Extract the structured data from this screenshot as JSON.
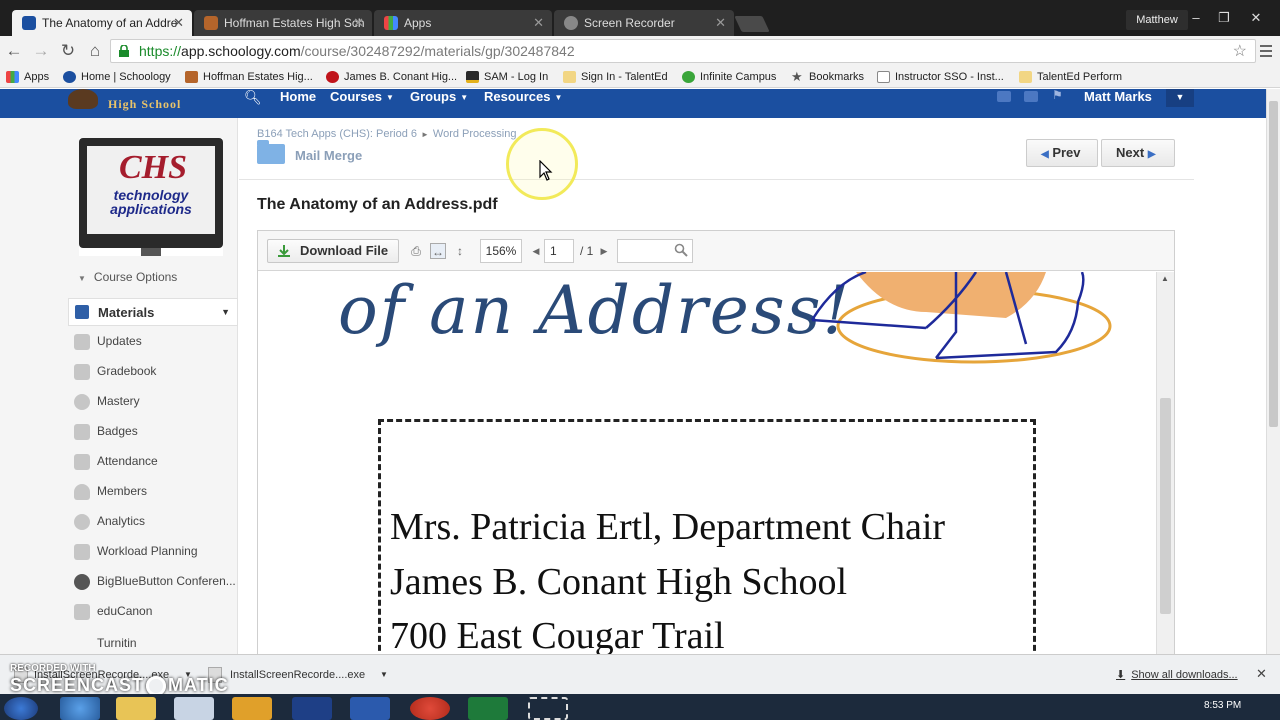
{
  "browser": {
    "tabs": [
      {
        "label": "The Anatomy of an Addre",
        "icon": "schoology-icon",
        "active": true
      },
      {
        "label": "Hoffman Estates High Sch",
        "icon": "site-icon",
        "active": false
      },
      {
        "label": "Apps",
        "icon": "apps-grid-icon",
        "active": false
      },
      {
        "label": "Screen Recorder",
        "icon": "recorder-icon",
        "active": false
      }
    ],
    "profile": "Matthew",
    "url": {
      "scheme": "https://",
      "host": "app.schoology.com",
      "path": "/course/302487292/materials/gp/302487842"
    }
  },
  "bookmarks": [
    {
      "label": "Apps",
      "icon": "apps-grid-icon"
    },
    {
      "label": "Home | Schoology",
      "icon": "schoology-icon"
    },
    {
      "label": "Hoffman Estates Hig...",
      "icon": "site-icon"
    },
    {
      "label": "James B. Conant Hig...",
      "icon": "paw-icon"
    },
    {
      "label": "SAM - Log In",
      "icon": "sam-icon"
    },
    {
      "label": "Sign In - TalentEd",
      "icon": "folder-icon"
    },
    {
      "label": "Infinite Campus",
      "icon": "campus-icon"
    },
    {
      "label": "Bookmarks",
      "icon": "star-icon"
    },
    {
      "label": "Instructor SSO - Inst...",
      "icon": "page-icon"
    },
    {
      "label": "TalentEd Perform",
      "icon": "folder-icon"
    }
  ],
  "header": {
    "school_name": "High School",
    "nav": [
      {
        "label": "Home",
        "dropdown": false
      },
      {
        "label": "Courses",
        "dropdown": true
      },
      {
        "label": "Groups",
        "dropdown": true
      },
      {
        "label": "Resources",
        "dropdown": true
      }
    ],
    "user": "Matt Marks"
  },
  "sidebar": {
    "course_pic": {
      "big": "CHS",
      "sub": "technology applications"
    },
    "course_options": "Course Options",
    "materials": "Materials",
    "items": [
      {
        "label": "Updates",
        "icon": "updates-icon"
      },
      {
        "label": "Gradebook",
        "icon": "gradebook-icon"
      },
      {
        "label": "Mastery",
        "icon": "mastery-icon"
      },
      {
        "label": "Badges",
        "icon": "badges-icon"
      },
      {
        "label": "Attendance",
        "icon": "attendance-icon"
      },
      {
        "label": "Members",
        "icon": "members-icon"
      },
      {
        "label": "Analytics",
        "icon": "analytics-icon"
      },
      {
        "label": "Workload Planning",
        "icon": "workload-icon"
      },
      {
        "label": "BigBlueButton Conferen...",
        "icon": "bigbluebutton-icon"
      },
      {
        "label": "eduCanon",
        "icon": "educanon-icon"
      },
      {
        "label": "Turnitin",
        "icon": "turnitin-icon"
      }
    ]
  },
  "content": {
    "breadcrumb": [
      "B164 Tech Apps (CHS): Period 6",
      "Word Processing"
    ],
    "folder": "Mail Merge",
    "prev": "Prev",
    "next": "Next",
    "doc_title": "The Anatomy of an Address.pdf"
  },
  "viewer": {
    "download": "Download File",
    "zoom": "156%",
    "page": "1",
    "total": "/ 1",
    "search_placeholder": ""
  },
  "pdf": {
    "script_title": "of an Address!",
    "address_lines": [
      "Mrs. Patricia Ertl, Department Chair",
      "James B. Conant High School",
      "700 East Cougar Trail"
    ]
  },
  "downloads": {
    "items": [
      "InstallScreenRecorde....exe",
      "InstallScreenRecorde....exe"
    ],
    "show_all": "Show all downloads...",
    "watermark_top": "RECORDED WITH",
    "watermark_brand_a": "SCREENCAST",
    "watermark_brand_b": "MATIC"
  },
  "taskbar": {
    "clock": "8:53 PM"
  },
  "colors": {
    "schoology_blue": "#1b4fa0",
    "accent_link": "#8b9fb8",
    "url_green": "#1a8a2a"
  }
}
